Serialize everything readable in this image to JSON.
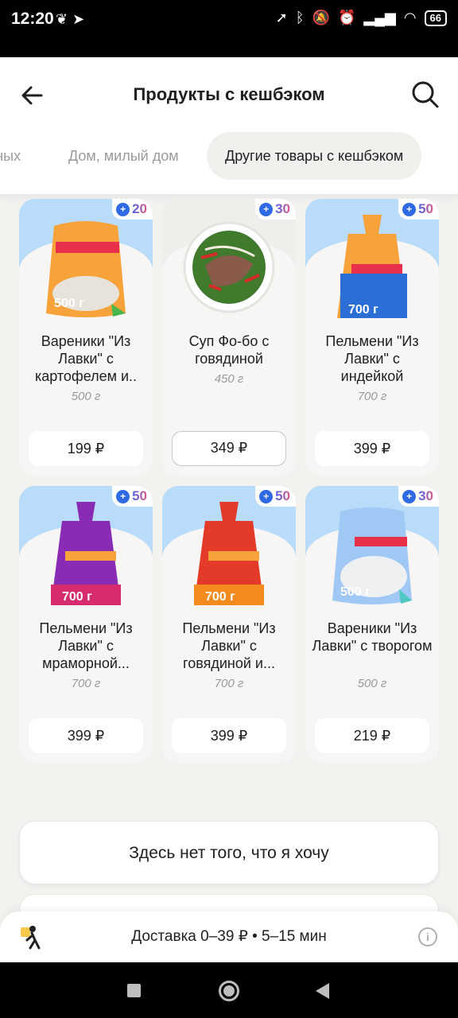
{
  "status_bar": {
    "time": "12:20",
    "battery": "66",
    "left_icons": [
      "leaf-icon",
      "telegram-icon"
    ],
    "right_icons": [
      "location-icon",
      "bluetooth-icon",
      "mute-icon",
      "alarm-icon",
      "signal-icon",
      "wifi-icon",
      "battery-icon"
    ]
  },
  "header": {
    "title": "Продукты с кешбэком",
    "tabs": [
      {
        "label": "тных",
        "active": false
      },
      {
        "label": "Дом, милый дом",
        "active": false
      },
      {
        "label": "Другие товары с кешбэком",
        "active": true
      }
    ]
  },
  "products": [
    {
      "name": "Вареники \"Из Лавки\" с картофелем и..",
      "weight": "500 г",
      "price": "199 ₽",
      "cashback": "20",
      "image": "dumplings-bag-orange"
    },
    {
      "name": "Суп Фо-бо с говядиной",
      "weight": "450 г",
      "price": "349 ₽",
      "cashback": "30",
      "image": "pho-soup-bowl"
    },
    {
      "name": "Пельмени \"Из Лавки\" с индейкой",
      "weight": "700 г",
      "price": "399 ₽",
      "cashback": "50",
      "image": "dumplings-bag-blue-orange"
    },
    {
      "name": "Пельмени \"Из Лавки\" с мраморной...",
      "weight": "700 г",
      "price": "399 ₽",
      "cashback": "50",
      "image": "dumplings-bag-purple"
    },
    {
      "name": "Пельмени \"Из Лавки\" с говядиной и...",
      "weight": "700 г",
      "price": "399 ₽",
      "cashback": "50",
      "image": "dumplings-bag-red-orange"
    },
    {
      "name": "Вареники \"Из Лавки\" с творогом",
      "weight": "500 г",
      "price": "219 ₽",
      "cashback": "30",
      "image": "dumplings-bag-light-blue"
    }
  ],
  "lower": {
    "want_button": "Здесь нет того, что я хочу"
  },
  "delivery": {
    "text": "Доставка 0–39 ₽  •  5–15 мин"
  },
  "colors": {
    "accent_blue": "#2f6ae5",
    "card_bg": "#f7f6f4",
    "page_bg": "#f3f2ef"
  }
}
